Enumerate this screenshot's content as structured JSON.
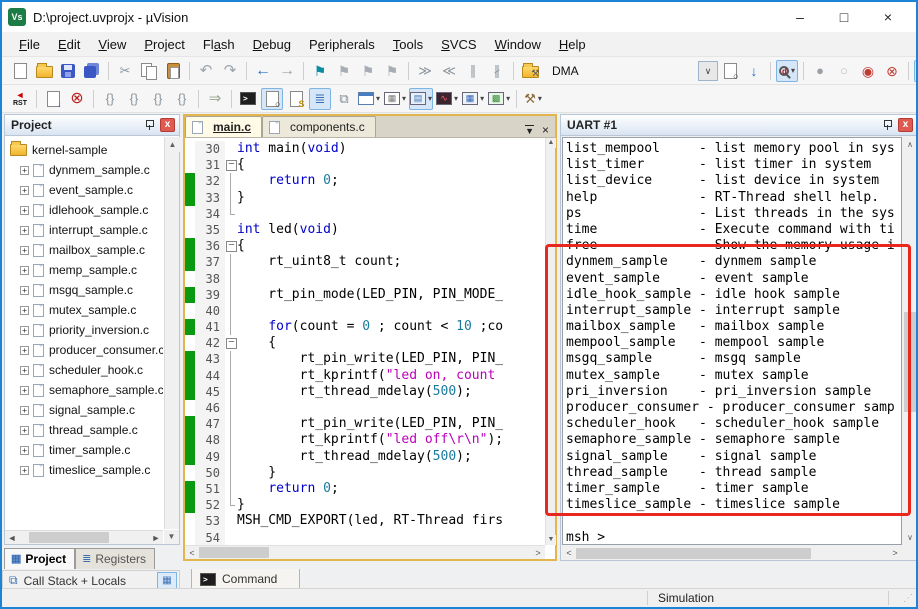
{
  "window": {
    "title": "D:\\project.uvprojx - µVision",
    "controls": {
      "minimize": "–",
      "maximize": "□",
      "close": "×"
    }
  },
  "menu": {
    "items": [
      {
        "label": "File",
        "u": 0
      },
      {
        "label": "Edit",
        "u": 0
      },
      {
        "label": "View",
        "u": 0
      },
      {
        "label": "Project",
        "u": 0
      },
      {
        "label": "Flash",
        "u": 2
      },
      {
        "label": "Debug",
        "u": 0
      },
      {
        "label": "Peripherals",
        "u": 1
      },
      {
        "label": "Tools",
        "u": 0
      },
      {
        "label": "SVCS",
        "u": 0
      },
      {
        "label": "Window",
        "u": 0
      },
      {
        "label": "Help",
        "u": 0
      }
    ]
  },
  "toolbar1a": [
    {
      "name": "new-file-button",
      "kind": "page"
    },
    {
      "name": "open-button",
      "kind": "folder"
    },
    {
      "name": "save-button",
      "kind": "floppy"
    },
    {
      "name": "save-all-button",
      "kind": "floppy2"
    },
    {
      "sep": true
    },
    {
      "name": "cut-button",
      "kind": "g",
      "glyph": "✂",
      "color": "#8b949c"
    },
    {
      "name": "copy-button",
      "kind": "copy"
    },
    {
      "name": "paste-button",
      "kind": "clip"
    },
    {
      "sep": true
    },
    {
      "name": "undo-button",
      "kind": "g",
      "glyph": "↶",
      "color": "#9aa4ad",
      "size": 15
    },
    {
      "name": "redo-button",
      "kind": "g",
      "glyph": "↷",
      "color": "#9aa4ad",
      "size": 15
    },
    {
      "sep": true
    },
    {
      "name": "navigate-back-button",
      "kind": "g",
      "glyph": "←",
      "color": "#2e6fc4",
      "size": 16
    },
    {
      "name": "navigate-forward-button",
      "kind": "g",
      "glyph": "→",
      "color": "#9aa4ad",
      "size": 16
    },
    {
      "sep": true
    },
    {
      "name": "bookmark-toggle-button",
      "kind": "g",
      "glyph": "⚑",
      "color": "#0d8ba0",
      "size": 14
    },
    {
      "name": "bookmark-prev-button",
      "kind": "g",
      "glyph": "⚑",
      "color": "#a8adb5",
      "size": 14
    },
    {
      "name": "bookmark-next-button",
      "kind": "g",
      "glyph": "⚑",
      "color": "#a8adb5",
      "size": 14
    },
    {
      "name": "bookmark-clear-button",
      "kind": "g",
      "glyph": "⚑",
      "color": "#a8adb5",
      "size": 14
    },
    {
      "sep": true
    },
    {
      "name": "indent-right-button",
      "kind": "g",
      "glyph": "≫",
      "color": "#8b949c"
    },
    {
      "name": "indent-left-button",
      "kind": "g",
      "glyph": "≪",
      "color": "#8b949c"
    },
    {
      "name": "comment-button",
      "kind": "g",
      "glyph": "∥",
      "color": "#8b949c"
    },
    {
      "name": "uncomment-button",
      "kind": "g",
      "glyph": "∦",
      "color": "#8b949c"
    },
    {
      "sep": true
    },
    {
      "name": "manage-target-button",
      "kind": "folder",
      "glyph": "⚒",
      "color": "#555"
    }
  ],
  "dma": {
    "value": "DMA"
  },
  "toolbar1b": [
    {
      "name": "find-in-files-button",
      "kind": "page",
      "glyph": "○",
      "color": "#333"
    },
    {
      "name": "find-next-button",
      "kind": "g",
      "glyph": "↓",
      "color": "#2e6fc4",
      "size": 14
    },
    {
      "sep": true
    },
    {
      "name": "quick-search-dropdown",
      "kind": "loupe",
      "glyph": "d",
      "color": "#c00",
      "active": true,
      "dd": true
    },
    {
      "sep": true
    },
    {
      "name": "breakpoint-filled-indicator",
      "kind": "g",
      "glyph": "●",
      "color": "#9aa0a6",
      "size": 13
    },
    {
      "name": "breakpoint-empty-indicator",
      "kind": "g",
      "glyph": "○",
      "color": "#b7bcc2",
      "size": 13
    },
    {
      "name": "toggle-breakpoint-button",
      "kind": "g",
      "glyph": "◉",
      "color": "#c23b33",
      "size": 14
    },
    {
      "name": "kill-breakpoints-button",
      "kind": "g",
      "glyph": "⊗",
      "color": "#c23b33",
      "size": 14
    },
    {
      "sep": true
    },
    {
      "name": "project-window-toggle",
      "kind": "win",
      "active": true
    }
  ],
  "toolbar2": [
    {
      "name": "reset-button",
      "kind": "rst",
      "label": "RST"
    },
    {
      "sep": true
    },
    {
      "name": "run-button",
      "kind": "page",
      "glyph": "↓",
      "color": "#2e6fc4"
    },
    {
      "name": "stop-button",
      "kind": "g",
      "glyph": "⊗",
      "color": "#b91c1c",
      "size": 16
    },
    {
      "sep": true
    },
    {
      "name": "step-into-button",
      "kind": "g",
      "glyph": "{}",
      "color": "#8b949c"
    },
    {
      "name": "step-over-button",
      "kind": "g",
      "glyph": "{}",
      "color": "#8b949c"
    },
    {
      "name": "step-out-button",
      "kind": "g",
      "glyph": "{}",
      "color": "#8b949c"
    },
    {
      "name": "run-to-line-button",
      "kind": "g",
      "glyph": "{}",
      "color": "#8b949c"
    },
    {
      "sep": true
    },
    {
      "name": "go-button",
      "kind": "g",
      "glyph": "⇒",
      "color": "#95a58f",
      "size": 15
    },
    {
      "sep": true
    },
    {
      "name": "command-window-button",
      "kind": "console",
      "glyph": ">"
    },
    {
      "name": "disassembly-window-button",
      "kind": "page",
      "glyph": "○",
      "color": "#333",
      "active": true
    },
    {
      "name": "symbol-window-button",
      "kind": "page",
      "glyph": "S",
      "color": "#c79500"
    },
    {
      "name": "registers-window-button",
      "kind": "g",
      "glyph": "≣",
      "color": "#3b6fb3",
      "active": true
    },
    {
      "name": "callstack-window-button",
      "kind": "g",
      "glyph": "⧉",
      "color": "#7f8a94"
    },
    {
      "name": "watch-window-dropdown",
      "kind": "win",
      "dd": true
    },
    {
      "name": "memory-window-dropdown",
      "kind": "box",
      "bg": "#ffffff",
      "glyph": "▦",
      "color": "#777",
      "dd": true
    },
    {
      "name": "serial-window-dropdown",
      "kind": "box",
      "bg": "#e8f0fa",
      "glyph": "▤",
      "color": "#3b6fb3",
      "dd": true,
      "active": true
    },
    {
      "name": "analysis-window-dropdown",
      "kind": "box",
      "bg": "#3a2430",
      "glyph": "∿",
      "color": "#ff5f5f",
      "dd": true
    },
    {
      "name": "systemviewer-window-dropdown",
      "kind": "box",
      "bg": "#eef3fa",
      "glyph": "▦",
      "color": "#2e5fb3",
      "dd": true
    },
    {
      "name": "logicanalyzer-window-dropdown",
      "kind": "box",
      "bg": "#e9f5e9",
      "glyph": "▩",
      "color": "#2e8b2e",
      "dd": true
    },
    {
      "sep": true
    },
    {
      "name": "toolbox-dropdown",
      "kind": "g",
      "glyph": "⚒",
      "color": "#8a6d3b",
      "dd": true
    }
  ],
  "project": {
    "title": "Project",
    "root": "kernel-sample",
    "files": [
      "dynmem_sample.c",
      "event_sample.c",
      "idlehook_sample.c",
      "interrupt_sample.c",
      "mailbox_sample.c",
      "memp_sample.c",
      "msgq_sample.c",
      "mutex_sample.c",
      "priority_inversion.c",
      "producer_consumer.c",
      "scheduler_hook.c",
      "semaphore_sample.c",
      "signal_sample.c",
      "thread_sample.c",
      "timer_sample.c",
      "timeslice_sample.c"
    ],
    "tabs": [
      {
        "label": "Project",
        "active": true
      },
      {
        "label": "Registers",
        "active": false
      }
    ],
    "callstack_label": "Call Stack + Locals"
  },
  "editor": {
    "tabs": [
      {
        "label": "main.c",
        "active": true
      },
      {
        "label": "components.c",
        "active": false
      }
    ],
    "lines": [
      {
        "n": 30,
        "g": false,
        "f": "",
        "s": [
          [
            "k",
            "int"
          ],
          [
            "p",
            " main("
          ],
          [
            "k",
            "void"
          ],
          [
            "p",
            ")"
          ]
        ]
      },
      {
        "n": 31,
        "g": false,
        "f": "b",
        "s": [
          [
            "p",
            "{"
          ]
        ]
      },
      {
        "n": 32,
        "g": true,
        "f": "l",
        "s": [
          [
            "p",
            "    "
          ],
          [
            "k",
            "return"
          ],
          [
            "p",
            " "
          ],
          [
            "n",
            "0"
          ],
          [
            "p",
            ";"
          ]
        ]
      },
      {
        "n": 33,
        "g": true,
        "f": "l",
        "s": [
          [
            "p",
            "}"
          ]
        ]
      },
      {
        "n": 34,
        "g": false,
        "f": "e",
        "s": []
      },
      {
        "n": 35,
        "g": false,
        "f": "",
        "s": [
          [
            "k",
            "int"
          ],
          [
            "p",
            " led("
          ],
          [
            "k",
            "void"
          ],
          [
            "p",
            ")"
          ]
        ]
      },
      {
        "n": 36,
        "g": true,
        "f": "b",
        "s": [
          [
            "p",
            "{"
          ]
        ]
      },
      {
        "n": 37,
        "g": true,
        "f": "l",
        "s": [
          [
            "p",
            "    rt_uint8_t count;"
          ]
        ]
      },
      {
        "n": 38,
        "g": false,
        "f": "l",
        "s": []
      },
      {
        "n": 39,
        "g": true,
        "f": "l",
        "s": [
          [
            "p",
            "    rt_pin_mode(LED_PIN, PIN_MODE_"
          ]
        ]
      },
      {
        "n": 40,
        "g": false,
        "f": "l",
        "s": []
      },
      {
        "n": 41,
        "g": true,
        "f": "l",
        "s": [
          [
            "p",
            "    "
          ],
          [
            "k",
            "for"
          ],
          [
            "p",
            "(count = "
          ],
          [
            "n",
            "0"
          ],
          [
            "p",
            " ; count < "
          ],
          [
            "n",
            "10"
          ],
          [
            "p",
            " ;co"
          ]
        ]
      },
      {
        "n": 42,
        "g": false,
        "f": "b",
        "s": [
          [
            "p",
            "    {"
          ]
        ]
      },
      {
        "n": 43,
        "g": true,
        "f": "l",
        "s": [
          [
            "p",
            "        rt_pin_write(LED_PIN, PIN_"
          ]
        ]
      },
      {
        "n": 44,
        "g": true,
        "f": "l",
        "s": [
          [
            "p",
            "        rt_kprintf("
          ],
          [
            "s",
            "\"led on, count"
          ]
        ]
      },
      {
        "n": 45,
        "g": true,
        "f": "l",
        "s": [
          [
            "p",
            "        rt_thread_mdelay("
          ],
          [
            "n",
            "500"
          ],
          [
            "p",
            ");"
          ]
        ]
      },
      {
        "n": 46,
        "g": false,
        "f": "l",
        "s": []
      },
      {
        "n": 47,
        "g": true,
        "f": "l",
        "s": [
          [
            "p",
            "        rt_pin_write(LED_PIN, PIN_"
          ]
        ]
      },
      {
        "n": 48,
        "g": true,
        "f": "l",
        "s": [
          [
            "p",
            "        rt_kprintf("
          ],
          [
            "s",
            "\"led off\\r\\n\""
          ],
          [
            "p",
            ");"
          ]
        ]
      },
      {
        "n": 49,
        "g": true,
        "f": "l",
        "s": [
          [
            "p",
            "        rt_thread_mdelay("
          ],
          [
            "n",
            "500"
          ],
          [
            "p",
            ");"
          ]
        ]
      },
      {
        "n": 50,
        "g": false,
        "f": "l",
        "s": [
          [
            "p",
            "    }"
          ]
        ]
      },
      {
        "n": 51,
        "g": true,
        "f": "l",
        "s": [
          [
            "p",
            "    "
          ],
          [
            "k",
            "return"
          ],
          [
            "p",
            " "
          ],
          [
            "n",
            "0"
          ],
          [
            "p",
            ";"
          ]
        ]
      },
      {
        "n": 52,
        "g": true,
        "f": "e",
        "s": [
          [
            "p",
            "}"
          ]
        ]
      },
      {
        "n": 53,
        "g": false,
        "f": "",
        "s": [
          [
            "p",
            "MSH_CMD_EXPORT(led, RT-Thread firs"
          ]
        ]
      },
      {
        "n": 54,
        "g": false,
        "f": "",
        "s": []
      }
    ]
  },
  "uart": {
    "title": "UART #1",
    "lines": [
      "list_mempool     - list memory pool in sys",
      "list_timer       - list timer in system",
      "list_device      - list device in system",
      "help             - RT-Thread shell help.",
      "ps               - List threads in the sys",
      "time             - Execute command with ti",
      "free             - Show the memory usage i",
      "dynmem_sample    - dynmem sample",
      "event_sample     - event sample",
      "idle_hook_sample - idle hook sample",
      "interrupt_sample - interrupt sample",
      "mailbox_sample   - mailbox sample",
      "mempool_sample   - mempool sample",
      "msgq_sample      - msgq sample",
      "mutex_sample     - mutex sample",
      "pri_inversion    - pri_inversion sample",
      "producer_consumer - producer_consumer samp",
      "scheduler_hook   - scheduler_hook sample",
      "semaphore_sample - semaphore sample",
      "signal_sample    - signal sample",
      "thread_sample    - thread sample",
      "timer_sample     - timer sample",
      "timeslice_sample - timeslice sample",
      "",
      "msh >"
    ]
  },
  "command": {
    "label": "Command"
  },
  "statusbar": {
    "mode": "Simulation"
  },
  "colors": {
    "keyword": "#0000cc",
    "number": "#1a7a9e",
    "string": "#bb00bb",
    "green_bar": "#0a9a10",
    "annotation": "#e8281e"
  }
}
